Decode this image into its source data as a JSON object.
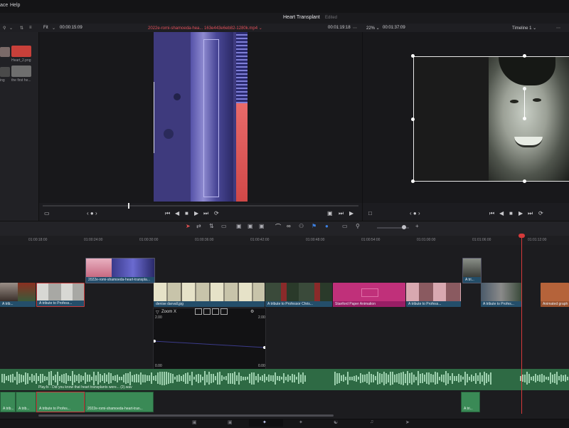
{
  "menu": {
    "items": [
      "ace",
      "Help"
    ]
  },
  "project": {
    "title": "Heart Transplant",
    "status": "Edited"
  },
  "source_viewer": {
    "zoom": "Fit",
    "timecode_left": "00:00:15:09",
    "clip_name": "2022e-romi-shamoeda-hea... 163e443e6eb82-1280k.mp4 ⌄",
    "timecode_right": "00:01:19:18"
  },
  "timeline_viewer": {
    "zoom": "22% ⌄",
    "timecode": "00:01:37:09",
    "timeline_name": "Timeline 1 ⌄"
  },
  "media_pool": {
    "items": [
      {
        "label": "Heart_2.png"
      },
      {
        "label": "the first he..."
      },
      {
        "label": "ing"
      }
    ]
  },
  "ruler": {
    "ticks": [
      "01:00:18:00",
      "01:00:24:00",
      "01:00:30:00",
      "01:00:36:00",
      "01:00:42:00",
      "01:00:48:00",
      "01:00:54:00",
      "01:01:00:00",
      "01:01:06:00",
      "01:01:12:00"
    ]
  },
  "clips": {
    "v2": [
      {
        "label": "2022e-romi-shamoeda-heart-transpla..."
      },
      {
        "label": "A tri..."
      }
    ],
    "v1": [
      {
        "label": "A trib..."
      },
      {
        "label": "A tribute to Profess..."
      },
      {
        "label": "denise darvall.jpg"
      },
      {
        "label": "A tribute to Professor Chris..."
      },
      {
        "label": "Stanford Paper Animation"
      },
      {
        "label": "A tribute to Profess..."
      },
      {
        "label": "A tribute to Profes..."
      },
      {
        "label": "Animated graph d..."
      }
    ]
  },
  "curve_editor": {
    "title": "Zoom X",
    "y_top_left": "2.00",
    "y_top_right": "2.00",
    "y_bottom_left": "0.00",
    "y_bottom_right": "0.00"
  },
  "audio": {
    "a1_label": "Play.fx - Did you know that heart transplants were... (2).wav",
    "a2": [
      {
        "label": "A trib..."
      },
      {
        "label": "A trib..."
      },
      {
        "label": "A tribute to Profes..."
      },
      {
        "label": "2022e-romi-shamoeda-heart-tran..."
      },
      {
        "label": "A tri..."
      }
    ]
  },
  "colors": {
    "accent": "#d63a3a",
    "clip_blue": "#23506e",
    "clip_pink": "#c0307a",
    "audio_green": "#3a8a56",
    "orange_clip": "#b5633a"
  }
}
